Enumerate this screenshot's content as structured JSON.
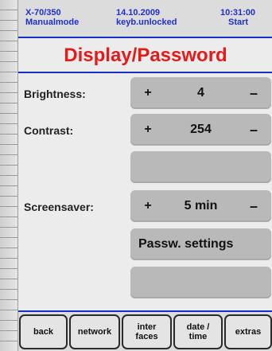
{
  "status": {
    "device": "X-70/350",
    "mode": "Manualmode",
    "date": "14.10.2009",
    "keyboard": "keyb.unlocked",
    "time": "10:31:00",
    "start": "Start"
  },
  "page": {
    "title": "Display/Password"
  },
  "settings": {
    "brightness": {
      "label": "Brightness:",
      "plus": "+",
      "value": "4",
      "minus": "–"
    },
    "contrast": {
      "label": "Contrast:",
      "plus": "+",
      "value": "254",
      "minus": "–"
    },
    "screensaver": {
      "label": "Screensaver:",
      "plus": "+",
      "value": "5 min",
      "minus": "–"
    },
    "password_button": "Passw. settings"
  },
  "nav": {
    "back": "back",
    "network": "network",
    "interfaces_line1": "inter",
    "interfaces_line2": "faces",
    "datetime_line1": "date /",
    "datetime_line2": "time",
    "extras": "extras"
  },
  "colors": {
    "accent_blue": "#1530c8",
    "title_red": "#e31b1b",
    "status_text": "#1f2fd0"
  }
}
